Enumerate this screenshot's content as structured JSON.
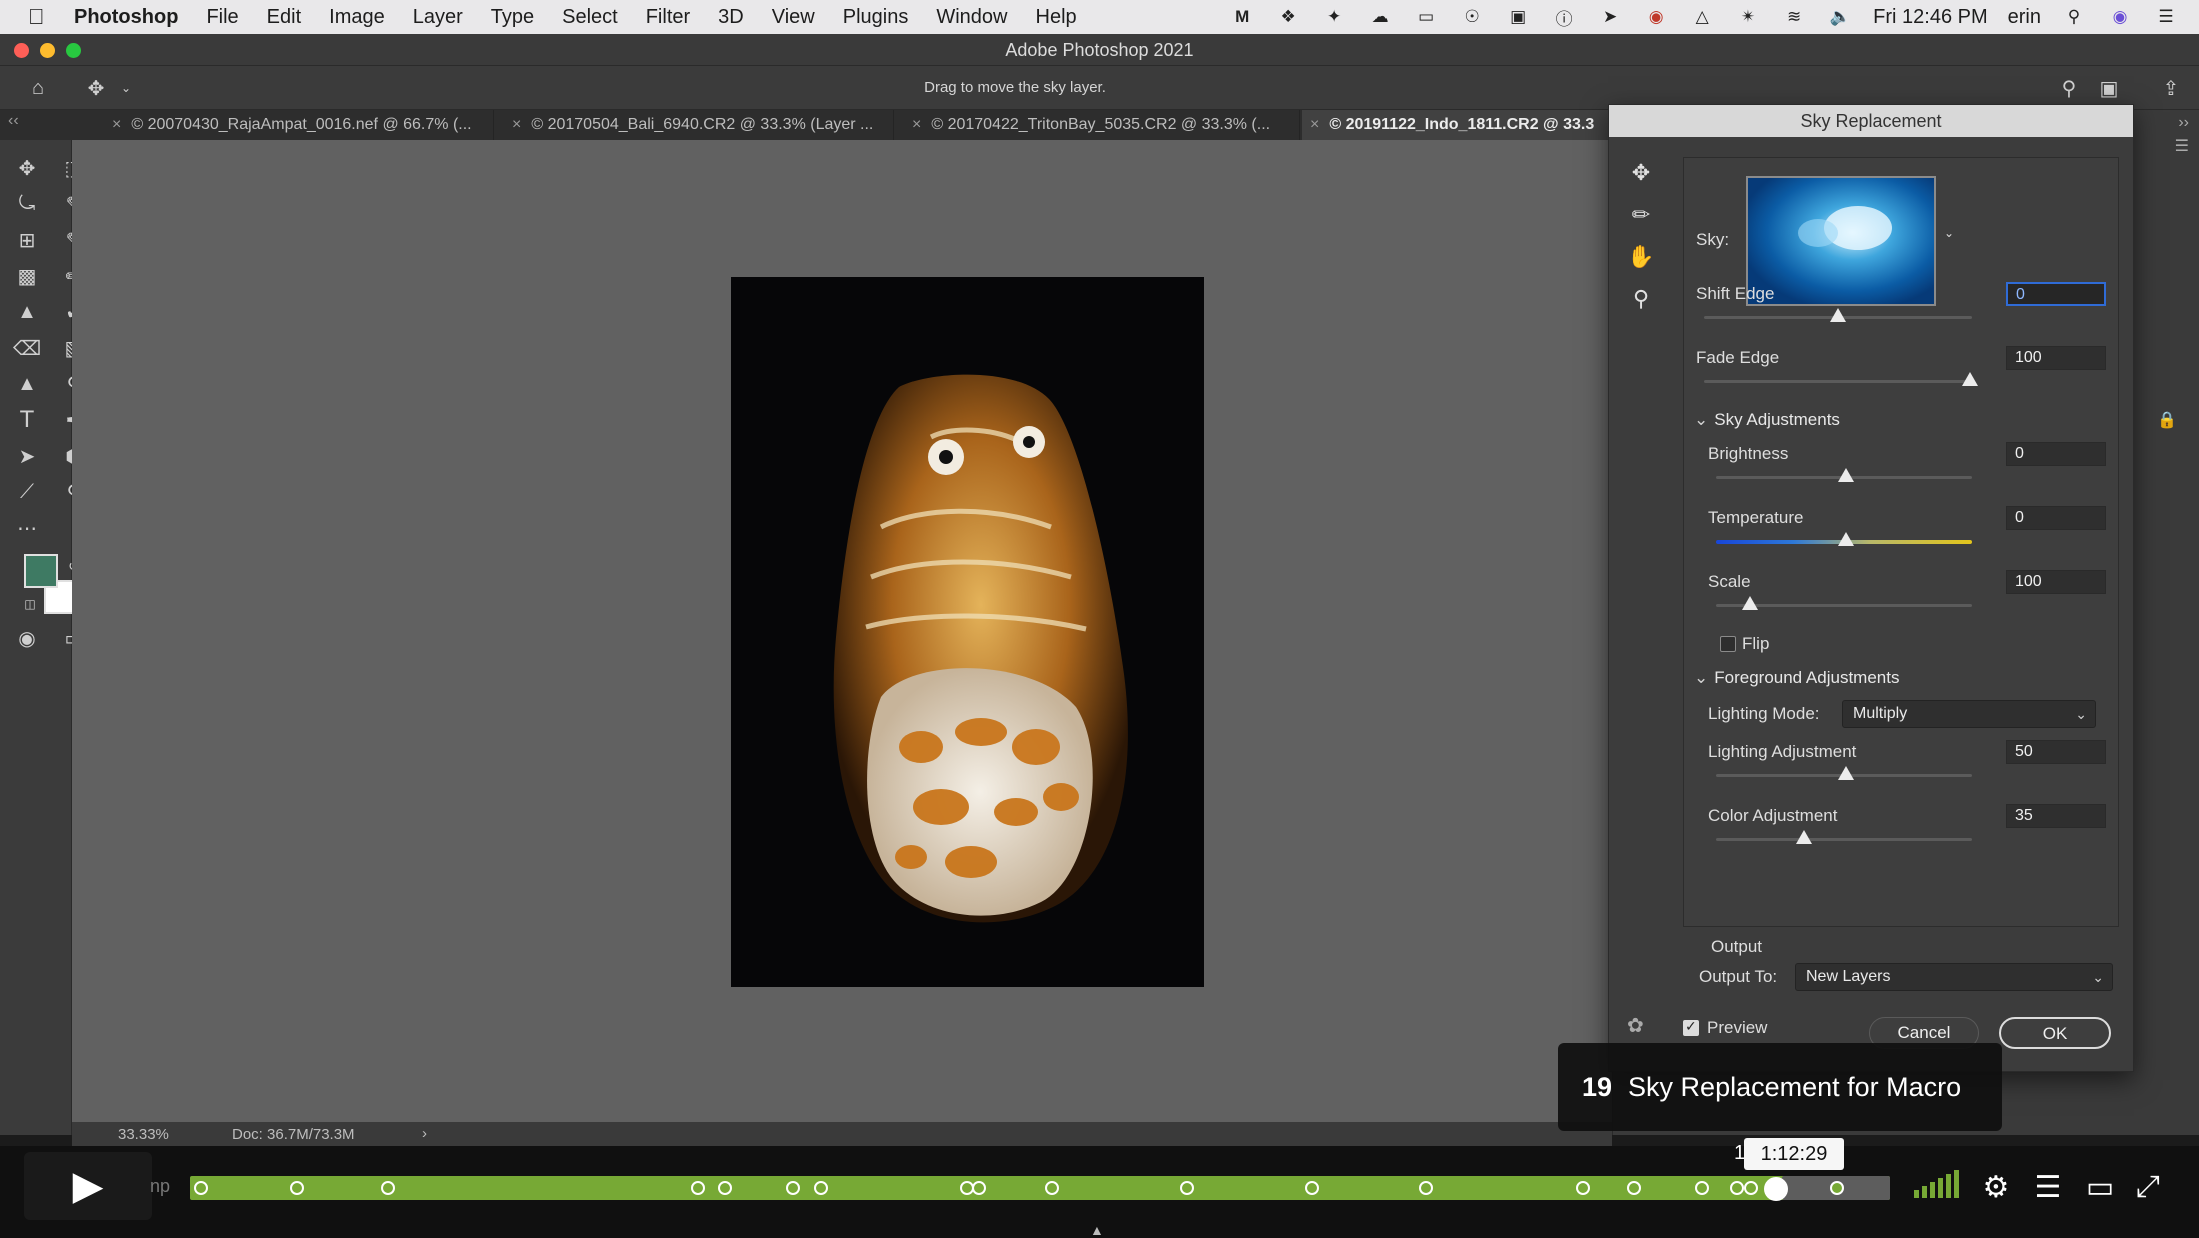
{
  "menubar": {
    "items": [
      "Photoshop",
      "File",
      "Edit",
      "Image",
      "Layer",
      "Type",
      "Select",
      "Filter",
      "3D",
      "View",
      "Plugins",
      "Window",
      "Help"
    ],
    "clock": "Fri 12:46 PM",
    "user": "erin"
  },
  "window": {
    "title": "Adobe Photoshop 2021",
    "hint": "Drag to move the sky layer."
  },
  "tabs": [
    {
      "label": "© 20070430_RajaAmpat_0016.nef @ 66.7% (..."
    },
    {
      "label": "© 20170504_Bali_6940.CR2 @ 33.3% (Layer ..."
    },
    {
      "label": "© 20170422_TritonBay_5035.CR2 @ 33.3% (..."
    },
    {
      "label": "© 20191122_Indo_1811.CR2 @ 33.3"
    }
  ],
  "status": {
    "zoom": "33.33%",
    "doc": "Doc: 36.7M/73.3M"
  },
  "dialog": {
    "title": "Sky Replacement",
    "sky_label": "Sky:",
    "shift_edge": {
      "label": "Shift Edge",
      "value": "0",
      "level": 0.5
    },
    "fade_edge": {
      "label": "Fade Edge",
      "value": "100",
      "level": 1.0
    },
    "sky_adjustments": "Sky Adjustments",
    "brightness": {
      "label": "Brightness",
      "value": "0",
      "level": 0.5
    },
    "temperature": {
      "label": "Temperature",
      "value": "0",
      "level": 0.5
    },
    "scale": {
      "label": "Scale",
      "value": "100",
      "level": 0.13
    },
    "flip": "Flip",
    "foreground_adjustments": "Foreground Adjustments",
    "lighting_mode": {
      "label": "Lighting Mode:",
      "value": "Multiply"
    },
    "lighting_adjustment": {
      "label": "Lighting Adjustment",
      "value": "50",
      "level": 0.5
    },
    "color_adjustment": {
      "label": "Color Adjustment",
      "value": "35",
      "level": 0.35
    },
    "output_heading": "Output",
    "output_to": {
      "label": "Output To:",
      "value": "New Layers"
    },
    "preview": "Preview",
    "cancel": "Cancel",
    "ok": "OK"
  },
  "video": {
    "chapter_number": "19",
    "chapter_title": "Sky Replacement for Macro",
    "time": "1:12:29",
    "progress": 0.92,
    "partial_label_left": "np",
    "partial_label_time": "1"
  },
  "colors": {
    "accent_progress": "#77a935",
    "foreground_swatch": "#3e7a63",
    "background_swatch": "#ffffff"
  }
}
